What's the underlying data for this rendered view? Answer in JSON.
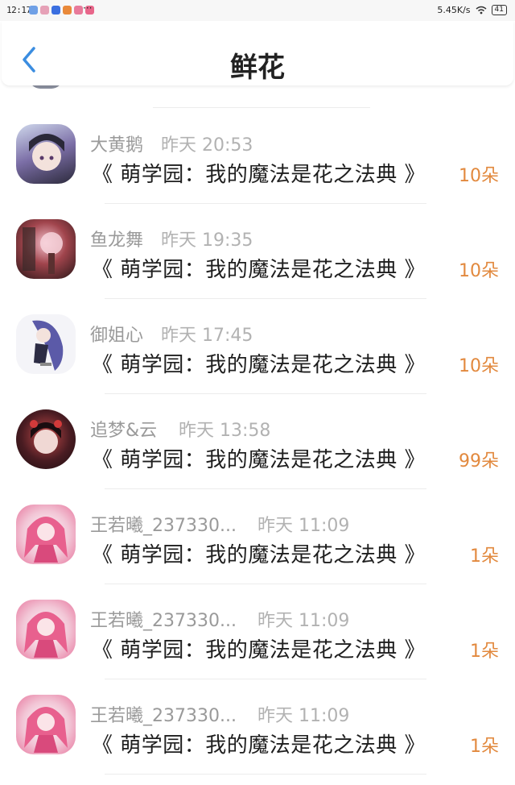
{
  "status_bar": {
    "time": "12:17",
    "net_speed": "5.45K/s",
    "battery": "41",
    "app_icon_colors": [
      "#6fa0e6",
      "#e6a1b7",
      "#3b6fe0",
      "#e9893a",
      "#e87a9a",
      "#e8668a"
    ]
  },
  "header": {
    "title": "鲜花",
    "back_icon": "chevron-left-icon",
    "accent_color": "#3b8de0"
  },
  "list": [
    {
      "name": "大黄鹅",
      "time": "昨天 20:53",
      "book": "《 萌学园：我的魔法是花之法典 》",
      "count": "10朵",
      "avatar_color": "#7b6ea6"
    },
    {
      "name": "鱼龙舞",
      "time": "昨天 19:35",
      "book": "《 萌学园：我的魔法是花之法典 》",
      "count": "10朵",
      "avatar_color": "#8b2f34"
    },
    {
      "name": "御姐心",
      "time": "昨天 17:45",
      "book": "《 萌学园：我的魔法是花之法典 》",
      "count": "10朵",
      "avatar_color": "#5b5aa8"
    },
    {
      "name": "追梦&云",
      "time": "昨天 13:58",
      "book": "《 萌学园：我的魔法是花之法典 》",
      "count": "99朵",
      "avatar_color": "#3a1f24"
    },
    {
      "name": "王若曦_237330...",
      "time": "昨天 11:09",
      "book": "《 萌学园：我的魔法是花之法典 》",
      "count": "1朵",
      "avatar_color": "#e8769e"
    },
    {
      "name": "王若曦_237330...",
      "time": "昨天 11:09",
      "book": "《 萌学园：我的魔法是花之法典 》",
      "count": "1朵",
      "avatar_color": "#e8769e"
    },
    {
      "name": "王若曦_237330...",
      "time": "昨天 11:09",
      "book": "《 萌学园：我的魔法是花之法典 》",
      "count": "1朵",
      "avatar_color": "#e8769e"
    }
  ]
}
